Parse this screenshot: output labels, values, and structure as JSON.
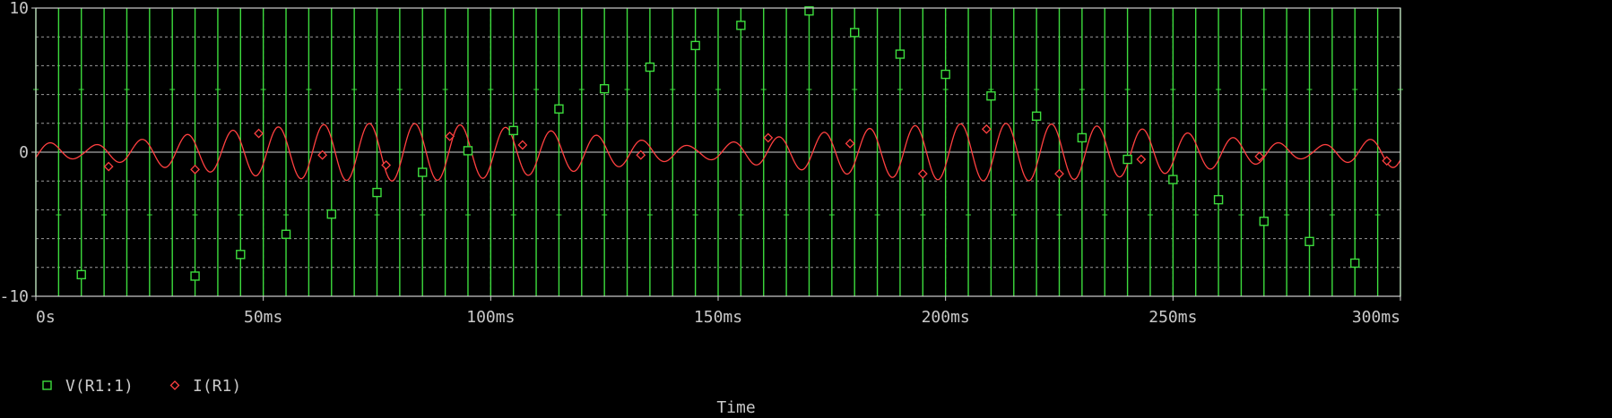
{
  "chart_data": {
    "type": "line",
    "xlabel": "Time",
    "ylabel": "",
    "xlim": [
      0,
      300
    ],
    "ylim": [
      -10,
      10
    ],
    "x_ticks": [
      0,
      50,
      100,
      150,
      200,
      250,
      300
    ],
    "x_tick_labels": [
      "0s",
      "50ms",
      "100ms",
      "150ms",
      "200ms",
      "250ms",
      "300ms"
    ],
    "y_ticks": [
      10,
      0,
      -10
    ],
    "y_tick_labels": [
      "10",
      "0",
      "-10"
    ],
    "y_minor_grid": [
      8,
      6,
      4,
      2,
      -2,
      -4,
      -6,
      -8
    ],
    "grid": "dotted horizontal",
    "legend_position": "bottom-left",
    "series": [
      {
        "name": "V(R1:1)",
        "color": "#3ddc3d",
        "marker": "square",
        "waveform": "sine, 10 V amplitude, ~100 Hz, sampled every 5 ms (drawn as vertical strokes)",
        "marker_points": [
          {
            "x": 10,
            "y": -8.5
          },
          {
            "x": 35,
            "y": -8.6
          },
          {
            "x": 45,
            "y": -7.1
          },
          {
            "x": 55,
            "y": -5.7
          },
          {
            "x": 65,
            "y": -4.3
          },
          {
            "x": 75,
            "y": -2.8
          },
          {
            "x": 85,
            "y": -1.4
          },
          {
            "x": 95,
            "y": 0.1
          },
          {
            "x": 105,
            "y": 1.5
          },
          {
            "x": 115,
            "y": 3.0
          },
          {
            "x": 125,
            "y": 4.4
          },
          {
            "x": 135,
            "y": 5.9
          },
          {
            "x": 145,
            "y": 7.4
          },
          {
            "x": 155,
            "y": 8.8
          },
          {
            "x": 170,
            "y": 9.8
          },
          {
            "x": 180,
            "y": 8.3
          },
          {
            "x": 190,
            "y": 6.8
          },
          {
            "x": 200,
            "y": 5.4
          },
          {
            "x": 210,
            "y": 3.9
          },
          {
            "x": 220,
            "y": 2.5
          },
          {
            "x": 230,
            "y": 1.0
          },
          {
            "x": 240,
            "y": -0.5
          },
          {
            "x": 250,
            "y": -1.9
          },
          {
            "x": 260,
            "y": -3.3
          },
          {
            "x": 270,
            "y": -4.8
          },
          {
            "x": 280,
            "y": -6.2
          },
          {
            "x": 290,
            "y": -7.7
          }
        ]
      },
      {
        "name": "I(R1)",
        "color": "#ff4040",
        "marker": "diamond",
        "waveform": "sinusoid, ~100 Hz, beating envelope peaking near ±2",
        "marker_points": [
          {
            "x": 16,
            "y": -1.0
          },
          {
            "x": 35,
            "y": -1.2
          },
          {
            "x": 49,
            "y": 1.3
          },
          {
            "x": 63,
            "y": -0.2
          },
          {
            "x": 77,
            "y": -0.9
          },
          {
            "x": 91,
            "y": 1.1
          },
          {
            "x": 107,
            "y": 0.5
          },
          {
            "x": 133,
            "y": -0.2
          },
          {
            "x": 161,
            "y": 1.0
          },
          {
            "x": 179,
            "y": 0.6
          },
          {
            "x": 195,
            "y": -1.5
          },
          {
            "x": 209,
            "y": 1.6
          },
          {
            "x": 225,
            "y": -1.5
          },
          {
            "x": 243,
            "y": -0.5
          },
          {
            "x": 269,
            "y": -0.3
          },
          {
            "x": 297,
            "y": -0.6
          }
        ]
      }
    ]
  }
}
